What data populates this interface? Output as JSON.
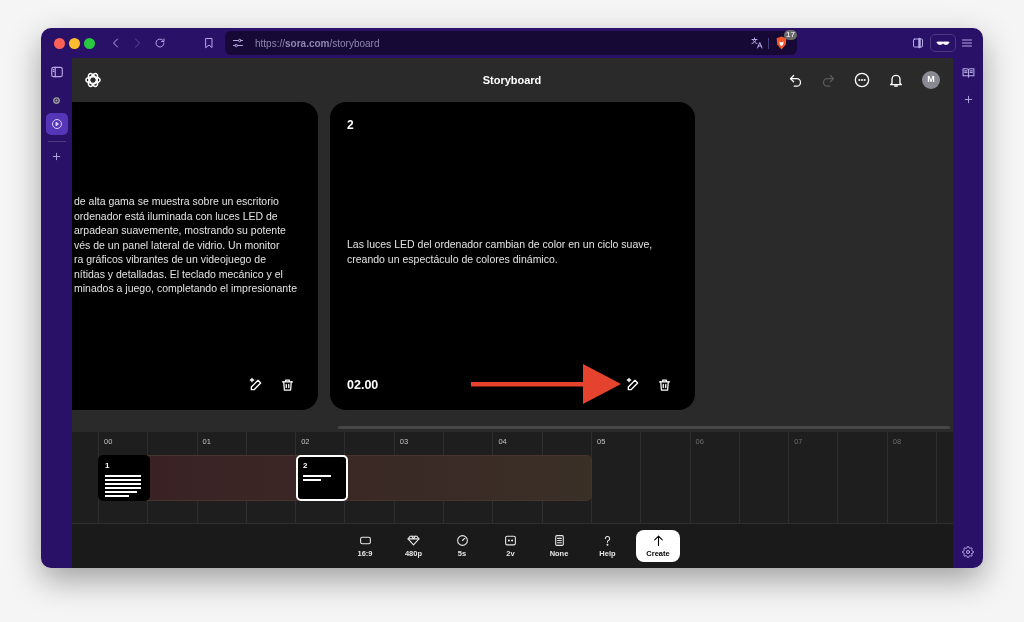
{
  "browser": {
    "nav": [
      {
        "disabled": false
      },
      {
        "disabled": true
      }
    ],
    "url": "https://**sora.com**/storyboard",
    "extension_badge": "17"
  },
  "sidebar": {
    "items": [
      {
        "selected": false
      },
      {
        "selected": true
      }
    ]
  },
  "header": {
    "title": "Storyboard",
    "history": [
      {
        "disabled": false
      },
      {
        "disabled": true
      }
    ],
    "avatar": "M"
  },
  "cards": [
    {
      "kind": "clipped",
      "lines": [
        "de alta gama se muestra sobre un escritorio",
        "ordenador está iluminada con luces LED de",
        "arpadean suavemente, mostrando su potente",
        "vés de un panel lateral de vidrio. Un monitor",
        "ra gráficos vibrantes de un videojuego de",
        "nítidas y detalladas. El teclado mecánico y el",
        "minados a juego, completando el impresionante"
      ]
    },
    {
      "kind": "full",
      "number": "2",
      "text": "Las luces LED del ordenador cambian de color en un ciclo suave, creando un espectáculo de colores dinámico.",
      "time": "02.00"
    }
  ],
  "timeline": {
    "ticks": [
      {
        "label": "00",
        "dimmed": false
      },
      {
        "label": "01",
        "dimmed": false
      },
      {
        "label": "02",
        "dimmed": false
      },
      {
        "label": "03",
        "dimmed": false
      },
      {
        "label": "04",
        "dimmed": false
      },
      {
        "label": "05",
        "dimmed": false
      },
      {
        "label": "06",
        "dimmed": true
      },
      {
        "label": "07",
        "dimmed": true
      },
      {
        "label": "08",
        "dimmed": true
      }
    ],
    "clips": [
      {
        "number": "1",
        "selected": false
      },
      {
        "number": "2",
        "selected": true
      }
    ]
  },
  "toolbar": [
    {
      "kind": "option",
      "label": "16:9"
    },
    {
      "kind": "option",
      "label": "480p"
    },
    {
      "kind": "option",
      "label": "5s"
    },
    {
      "kind": "option",
      "label": "2v"
    },
    {
      "kind": "option",
      "label": "None"
    },
    {
      "kind": "option",
      "label": "Help"
    },
    {
      "kind": "primary",
      "label": "Create"
    }
  ]
}
